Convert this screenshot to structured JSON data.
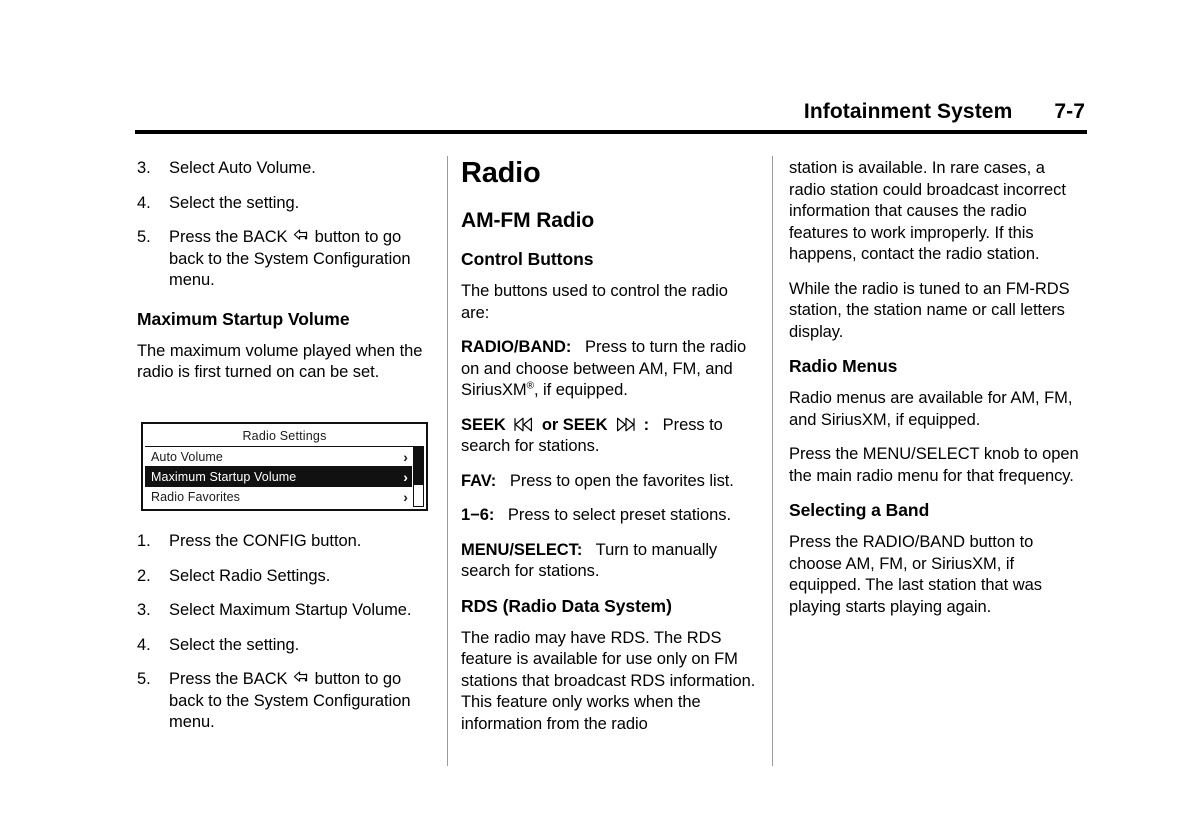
{
  "header": {
    "title": "Infotainment System",
    "page_number": "7-7"
  },
  "left_column": {
    "steps_top": [
      {
        "num": "3.",
        "text": "Select Auto Volume."
      },
      {
        "num": "4.",
        "text": "Select the setting."
      },
      {
        "num": "5.",
        "text_before": "Press the BACK",
        "text_after": "button to go back to the System Configuration menu."
      }
    ],
    "heading_max_startup": "Maximum Startup Volume",
    "paragraph_max_startup": "The maximum volume played when the radio is first turned on can be set.",
    "steps_bottom": [
      {
        "num": "1.",
        "text": "Press the CONFIG button."
      },
      {
        "num": "2.",
        "text": "Select Radio Settings."
      },
      {
        "num": "3.",
        "text": "Select Maximum Startup Volume."
      },
      {
        "num": "4.",
        "text": "Select the setting."
      },
      {
        "num": "5.",
        "text_before": "Press the BACK",
        "text_after": "button to go back to the System Configuration menu."
      }
    ]
  },
  "figure": {
    "screen_title": "Radio Settings",
    "rows": [
      {
        "label": "Auto Volume",
        "chevron": "›",
        "selected": false
      },
      {
        "label": "Maximum Startup Volume",
        "chevron": "›",
        "selected": true
      },
      {
        "label": "Radio Favorites",
        "chevron": "›",
        "selected": false
      }
    ]
  },
  "middle_column": {
    "title": "Radio",
    "subtitle": "AM-FM Radio",
    "section_control_buttons": "Control Buttons",
    "intro": "The buttons used to control the radio are:",
    "buttons": [
      {
        "lead": "RADIO/BAND:",
        "text_a": "Press to turn the radio on and choose between AM, FM, and SiriusXM",
        "reg": "®",
        "text_b": ", if equipped."
      },
      {
        "lead_a": "SEEK",
        "lead_b": "or SEEK",
        "lead_c": ":",
        "text": "Press to search for stations."
      },
      {
        "lead": "FAV:",
        "text": "Press to open the favorites list."
      },
      {
        "lead": "1−6:",
        "text": "Press to select preset stations."
      },
      {
        "lead": "MENU/SELECT:",
        "text": "Turn to manually search for stations."
      }
    ],
    "section_rds": "RDS (Radio Data System)",
    "rds_paragraph": "The radio may have RDS. The RDS feature is available for use only on FM stations that broadcast RDS information. This feature only works when the information from the radio"
  },
  "right_column": {
    "continued_paragraph": "station is available. In rare cases, a radio station could broadcast incorrect information that causes the radio features to work improperly. If this happens, contact the radio station.",
    "fm_rds_paragraph": "While the radio is tuned to an FM-RDS station, the station name or call letters display.",
    "section_radio_menus": "Radio Menus",
    "radio_menus_paragraph_1": "Radio menus are available for AM, FM, and SiriusXM, if equipped.",
    "radio_menus_paragraph_2": "Press the MENU/SELECT knob to open the main radio menu for that frequency.",
    "section_selecting_band": "Selecting a Band",
    "selecting_band_paragraph": "Press the RADIO/BAND button to choose AM, FM, or SiriusXM, if equipped. The last station that was playing starts playing again."
  },
  "icons": {
    "back_arrow": "back-arrow-icon",
    "seek_reverse": "seek-reverse-icon",
    "seek_forward": "seek-forward-icon",
    "chevron_right": "chevron-right-icon"
  },
  "colors": {
    "text": "#000000",
    "rule": "#000000",
    "divider": "#9b9b9b",
    "screen_border": "#111111",
    "screen_highlight": "#111111",
    "screen_highlight_text": "#ffffff"
  }
}
